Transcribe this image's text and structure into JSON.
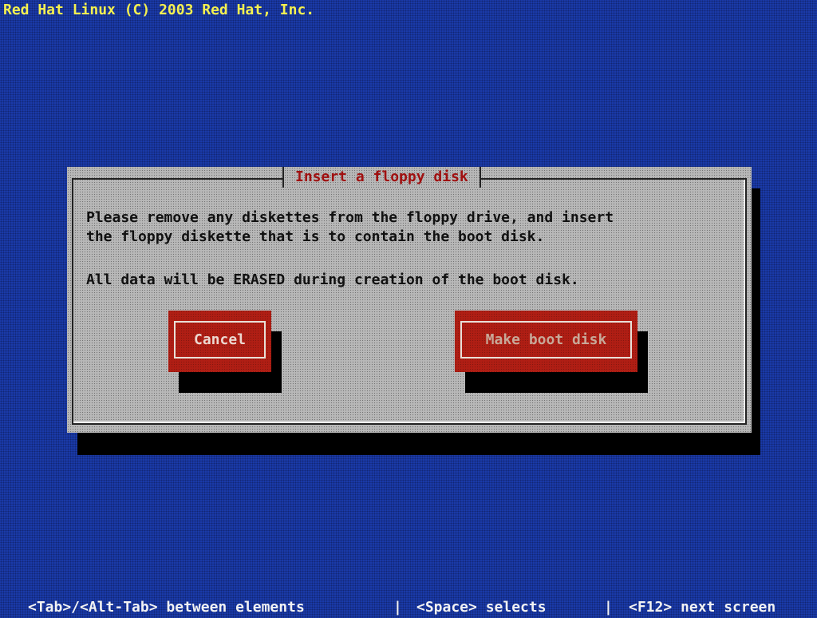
{
  "screen": {
    "title": "Red Hat Linux (C) 2003 Red Hat, Inc."
  },
  "dialog": {
    "title": "Insert a floppy disk",
    "line1": "Please remove any diskettes from the floppy drive, and insert",
    "line2": "the floppy diskette that is to contain the boot disk.",
    "line3": "All data will be ERASED during creation of the boot disk.",
    "cancel_label": "Cancel",
    "make_label": "Make boot disk"
  },
  "status_bar": {
    "hint1": "<Tab>/<Alt-Tab> between elements",
    "sep1": "|",
    "hint2": "<Space> selects",
    "sep2": "|",
    "hint3": "<F12> next screen"
  },
  "colors": {
    "background": "#1a3aa8",
    "title_text": "#f4f050",
    "dialog_bg": "#b8b8b8",
    "dialog_title": "#a01010",
    "button_bg": "#b01e14",
    "status_text": "#f2f2f2"
  }
}
